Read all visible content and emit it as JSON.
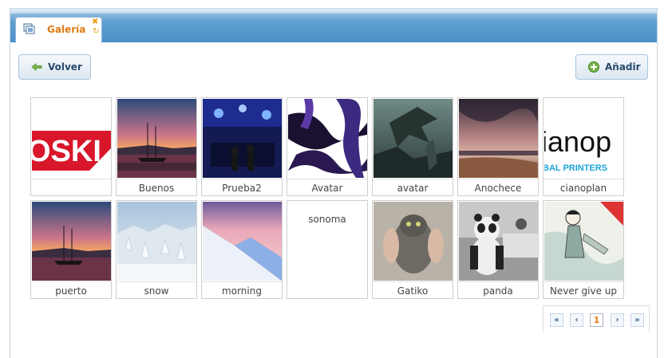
{
  "tab": {
    "label": "Galería"
  },
  "toolbar": {
    "back_label": "Volver",
    "add_label": "Añadir"
  },
  "gallery": {
    "items": [
      {
        "caption": ""
      },
      {
        "caption": "Buenos"
      },
      {
        "caption": "Prueba2"
      },
      {
        "caption": "Avatar"
      },
      {
        "caption": "avatar"
      },
      {
        "caption": "Anochece"
      },
      {
        "caption": "cianoplan"
      },
      {
        "caption": "puerto"
      },
      {
        "caption": "snow"
      },
      {
        "caption": "morning"
      },
      {
        "caption": "sonoma"
      },
      {
        "caption": "Gatiko"
      },
      {
        "caption": "panda"
      },
      {
        "caption": "Never give up"
      }
    ],
    "image_text": {
      "logo_red": "OSKI",
      "logo_cyan_top": "ianop",
      "logo_cyan_sub": "BAL PRINTERS"
    }
  },
  "pagination": {
    "first": "«",
    "prev": "‹",
    "current": "1",
    "next": "›",
    "last": "»"
  }
}
